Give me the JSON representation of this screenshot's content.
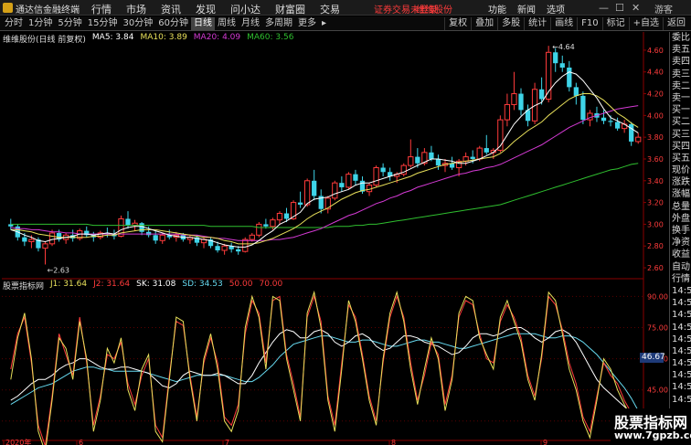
{
  "app": {
    "title": "通达信金融终端",
    "menu": [
      "行情",
      "市场",
      "资讯",
      "发现",
      "问小达",
      "财富圈",
      "交易"
    ],
    "notice": "证券交易未登录",
    "stock_link": "维维股份",
    "right_menu": [
      "功能",
      "新闻",
      "选项"
    ],
    "guest_label": "游客",
    "win_min": "—",
    "win_max": "☐",
    "win_close": "✕"
  },
  "toolbar": {
    "periods": [
      "分时",
      "1分钟",
      "5分钟",
      "15分钟",
      "30分钟",
      "60分钟",
      "日线",
      "周线",
      "月线",
      "多周期",
      "更多"
    ],
    "active_period": "日线",
    "more_arrow": "▸",
    "right_tools": [
      "复权",
      "叠加",
      "多股",
      "统计",
      "画线",
      "F10",
      "标记",
      "+自选",
      "返回"
    ]
  },
  "main_chart": {
    "stock_label": "维维股份(日线 前复权)",
    "ma_labels": [
      {
        "text": "MA5: 3.84",
        "color": "#ffffff"
      },
      {
        "text": "MA10: 3.89",
        "color": "#e8e05a"
      },
      {
        "text": "MA20: 4.09",
        "color": "#d43ad4"
      },
      {
        "text": "MA60: 3.56",
        "color": "#2fbf2f"
      }
    ],
    "y_ticks": [
      "4.60",
      "4.40",
      "4.20",
      "4.00",
      "3.80",
      "3.60",
      "3.40",
      "3.20",
      "3.00",
      "2.80",
      "2.60"
    ],
    "high_label": "4.64",
    "low_label": "2.63"
  },
  "indicator": {
    "title": "股票指标网",
    "values": [
      {
        "text": "J1: 31.64",
        "color": "#e8e05a"
      },
      {
        "text": "J2: 31.64",
        "color": "#ff3b3b"
      },
      {
        "text": "SK: 31.08",
        "color": "#ffffff"
      },
      {
        "text": "SD: 34.53",
        "color": "#66d9ef"
      },
      {
        "text": "50.00",
        "color": "#ff3b3b"
      },
      {
        "text": "70.00",
        "color": "#ff3b3b"
      }
    ],
    "y_ticks": [
      "90.00",
      "75.00",
      "60.00",
      "45.00",
      "30.00"
    ],
    "current_tag": "46.67"
  },
  "x_axis": {
    "labels": [
      "2020年",
      "6",
      "7",
      "8",
      "9"
    ]
  },
  "right_panel": {
    "items": [
      "委比",
      "卖五",
      "卖四",
      "卖三",
      "卖二",
      "卖一",
      "买一",
      "买二",
      "买三",
      "买四",
      "买五",
      "现价",
      "涨跌",
      "涨幅",
      "总量",
      "外盘",
      "换手",
      "净资",
      "收益",
      "自动",
      "行情",
      "14:56",
      "14:56",
      "14:56",
      "14:56",
      "14:56",
      "14:56",
      "14:56",
      "14:56",
      "14:56",
      "14:56"
    ]
  },
  "watermark": {
    "title": "股票指标网",
    "url": "www.7gpzb.com"
  },
  "colors": {
    "up": "#ff3b3b",
    "down": "#3ed4e8",
    "ma5": "#ffffff",
    "ma10": "#e8e05a",
    "ma20": "#d43ad4",
    "ma60": "#2fbf2f",
    "grid": "#5a0000"
  },
  "candles": [
    [
      3.0,
      3.05,
      2.95,
      2.98
    ],
    [
      2.98,
      3.0,
      2.85,
      2.88
    ],
    [
      2.88,
      2.92,
      2.8,
      2.84
    ],
    [
      2.84,
      2.9,
      2.78,
      2.86
    ],
    [
      2.86,
      2.88,
      2.75,
      2.78
    ],
    [
      2.78,
      2.84,
      2.63,
      2.82
    ],
    [
      2.82,
      2.95,
      2.8,
      2.92
    ],
    [
      2.92,
      2.95,
      2.84,
      2.86
    ],
    [
      2.86,
      2.92,
      2.82,
      2.9
    ],
    [
      2.9,
      2.95,
      2.84,
      2.87
    ],
    [
      2.87,
      2.96,
      2.85,
      2.94
    ],
    [
      2.94,
      2.98,
      2.88,
      2.9
    ],
    [
      2.9,
      2.93,
      2.84,
      2.88
    ],
    [
      2.88,
      2.94,
      2.86,
      2.92
    ],
    [
      2.92,
      2.97,
      2.88,
      2.91
    ],
    [
      2.91,
      2.95,
      2.86,
      2.89
    ],
    [
      2.89,
      3.08,
      2.88,
      3.05
    ],
    [
      3.05,
      3.12,
      2.96,
      2.99
    ],
    [
      2.99,
      3.04,
      2.94,
      3.01
    ],
    [
      3.01,
      3.02,
      2.9,
      2.93
    ],
    [
      2.93,
      2.98,
      2.88,
      2.9
    ],
    [
      2.9,
      2.94,
      2.82,
      2.85
    ],
    [
      2.85,
      2.92,
      2.82,
      2.9
    ],
    [
      2.9,
      2.95,
      2.86,
      2.88
    ],
    [
      2.88,
      2.93,
      2.84,
      2.9
    ],
    [
      2.9,
      2.92,
      2.84,
      2.86
    ],
    [
      2.86,
      2.9,
      2.82,
      2.88
    ],
    [
      2.88,
      2.9,
      2.8,
      2.83
    ],
    [
      2.83,
      2.88,
      2.78,
      2.86
    ],
    [
      2.86,
      2.88,
      2.78,
      2.8
    ],
    [
      2.8,
      2.84,
      2.74,
      2.76
    ],
    [
      2.76,
      2.82,
      2.72,
      2.8
    ],
    [
      2.8,
      2.83,
      2.74,
      2.77
    ],
    [
      2.77,
      2.8,
      2.72,
      2.75
    ],
    [
      2.75,
      2.88,
      2.74,
      2.86
    ],
    [
      2.86,
      2.92,
      2.84,
      2.9
    ],
    [
      2.9,
      3.02,
      2.88,
      3.0
    ],
    [
      3.0,
      3.05,
      2.96,
      2.98
    ],
    [
      2.98,
      3.06,
      2.95,
      3.04
    ],
    [
      3.04,
      3.12,
      3.0,
      3.1
    ],
    [
      3.1,
      3.15,
      3.02,
      3.05
    ],
    [
      3.05,
      3.22,
      3.04,
      3.2
    ],
    [
      3.2,
      3.3,
      3.15,
      3.18
    ],
    [
      3.18,
      3.42,
      3.16,
      3.4
    ],
    [
      3.4,
      3.5,
      3.22,
      3.26
    ],
    [
      3.26,
      3.32,
      3.1,
      3.14
    ],
    [
      3.14,
      3.26,
      3.1,
      3.24
    ],
    [
      3.24,
      3.4,
      3.22,
      3.38
    ],
    [
      3.38,
      3.44,
      3.3,
      3.34
    ],
    [
      3.34,
      3.48,
      3.32,
      3.46
    ],
    [
      3.46,
      3.5,
      3.36,
      3.4
    ],
    [
      3.4,
      3.44,
      3.28,
      3.3
    ],
    [
      3.3,
      3.38,
      3.26,
      3.36
    ],
    [
      3.36,
      3.54,
      3.34,
      3.52
    ],
    [
      3.52,
      3.56,
      3.44,
      3.48
    ],
    [
      3.48,
      3.52,
      3.4,
      3.44
    ],
    [
      3.44,
      3.48,
      3.38,
      3.46
    ],
    [
      3.46,
      3.56,
      3.44,
      3.54
    ],
    [
      3.54,
      3.78,
      3.52,
      3.62
    ],
    [
      3.62,
      3.7,
      3.52,
      3.56
    ],
    [
      3.56,
      3.7,
      3.54,
      3.66
    ],
    [
      3.66,
      3.72,
      3.58,
      3.6
    ],
    [
      3.6,
      3.64,
      3.5,
      3.54
    ],
    [
      3.54,
      3.6,
      3.48,
      3.56
    ],
    [
      3.56,
      3.62,
      3.5,
      3.52
    ],
    [
      3.52,
      3.6,
      3.44,
      3.58
    ],
    [
      3.58,
      3.66,
      3.54,
      3.62
    ],
    [
      3.62,
      3.68,
      3.56,
      3.6
    ],
    [
      3.6,
      3.72,
      3.58,
      3.7
    ],
    [
      3.7,
      3.82,
      3.64,
      3.66
    ],
    [
      3.66,
      3.7,
      3.6,
      3.68
    ],
    [
      3.68,
      4.0,
      3.66,
      3.96
    ],
    [
      3.96,
      4.2,
      3.9,
      4.1
    ],
    [
      4.1,
      4.4,
      4.05,
      4.2
    ],
    [
      4.2,
      4.25,
      4.0,
      4.05
    ],
    [
      4.05,
      4.1,
      3.9,
      3.95
    ],
    [
      3.95,
      4.3,
      3.92,
      4.24
    ],
    [
      4.24,
      4.35,
      4.1,
      4.15
    ],
    [
      4.15,
      4.64,
      4.12,
      4.58
    ],
    [
      4.58,
      4.62,
      4.4,
      4.48
    ],
    [
      4.48,
      4.55,
      4.4,
      4.44
    ],
    [
      4.44,
      4.5,
      4.22,
      4.26
    ],
    [
      4.26,
      4.3,
      4.1,
      4.18
    ],
    [
      4.18,
      4.22,
      3.92,
      3.96
    ],
    [
      3.96,
      4.05,
      3.9,
      4.02
    ],
    [
      4.02,
      4.08,
      3.94,
      3.98
    ],
    [
      3.98,
      4.05,
      3.92,
      3.95
    ],
    [
      3.95,
      4.0,
      3.9,
      3.94
    ],
    [
      3.94,
      3.98,
      3.86,
      3.88
    ],
    [
      3.88,
      3.96,
      3.84,
      3.92
    ],
    [
      3.92,
      3.94,
      3.72,
      3.76
    ],
    [
      3.76,
      3.84,
      3.74,
      3.8
    ]
  ],
  "ma_series": {
    "ma5": [
      2.95,
      2.93,
      2.9,
      2.88,
      2.85,
      2.84,
      2.86,
      2.87,
      2.88,
      2.89,
      2.91,
      2.91,
      2.9,
      2.91,
      2.92,
      2.91,
      2.95,
      2.97,
      2.98,
      2.98,
      2.96,
      2.94,
      2.92,
      2.9,
      2.89,
      2.88,
      2.88,
      2.87,
      2.86,
      2.85,
      2.83,
      2.81,
      2.8,
      2.79,
      2.79,
      2.81,
      2.85,
      2.9,
      2.94,
      3.0,
      3.03,
      3.07,
      3.11,
      3.19,
      3.23,
      3.24,
      3.25,
      3.28,
      3.3,
      3.32,
      3.36,
      3.38,
      3.38,
      3.4,
      3.42,
      3.44,
      3.46,
      3.48,
      3.51,
      3.54,
      3.57,
      3.6,
      3.6,
      3.59,
      3.58,
      3.56,
      3.56,
      3.58,
      3.6,
      3.63,
      3.66,
      3.72,
      3.82,
      3.92,
      3.99,
      4.05,
      4.09,
      4.12,
      4.22,
      4.3,
      4.36,
      4.4,
      4.38,
      4.32,
      4.24,
      4.16,
      4.06,
      3.98,
      3.95,
      3.92,
      3.88,
      3.84
    ],
    "ma10": [
      2.95,
      2.95,
      2.94,
      2.93,
      2.91,
      2.9,
      2.89,
      2.88,
      2.88,
      2.88,
      2.88,
      2.88,
      2.89,
      2.89,
      2.9,
      2.9,
      2.92,
      2.93,
      2.94,
      2.95,
      2.95,
      2.95,
      2.94,
      2.93,
      2.92,
      2.91,
      2.9,
      2.89,
      2.88,
      2.88,
      2.87,
      2.85,
      2.84,
      2.82,
      2.82,
      2.82,
      2.83,
      2.85,
      2.87,
      2.9,
      2.93,
      2.96,
      3.0,
      3.05,
      3.09,
      3.12,
      3.15,
      3.19,
      3.23,
      3.26,
      3.29,
      3.31,
      3.32,
      3.34,
      3.36,
      3.38,
      3.4,
      3.42,
      3.44,
      3.47,
      3.49,
      3.51,
      3.53,
      3.55,
      3.56,
      3.57,
      3.58,
      3.59,
      3.6,
      3.61,
      3.62,
      3.65,
      3.7,
      3.76,
      3.81,
      3.86,
      3.9,
      3.94,
      4.0,
      4.05,
      4.1,
      4.15,
      4.18,
      4.2,
      4.2,
      4.18,
      4.14,
      4.08,
      4.02,
      3.98,
      3.93,
      3.89
    ],
    "ma20": [
      2.97,
      2.96,
      2.96,
      2.95,
      2.95,
      2.94,
      2.93,
      2.93,
      2.92,
      2.92,
      2.91,
      2.91,
      2.91,
      2.91,
      2.91,
      2.91,
      2.91,
      2.91,
      2.91,
      2.91,
      2.91,
      2.91,
      2.91,
      2.91,
      2.91,
      2.9,
      2.9,
      2.9,
      2.89,
      2.88,
      2.87,
      2.87,
      2.86,
      2.85,
      2.85,
      2.85,
      2.85,
      2.85,
      2.86,
      2.86,
      2.87,
      2.88,
      2.9,
      2.92,
      2.94,
      2.96,
      2.99,
      3.02,
      3.05,
      3.08,
      3.1,
      3.13,
      3.16,
      3.19,
      3.21,
      3.24,
      3.26,
      3.29,
      3.31,
      3.34,
      3.36,
      3.38,
      3.4,
      3.42,
      3.44,
      3.46,
      3.47,
      3.49,
      3.5,
      3.52,
      3.53,
      3.55,
      3.58,
      3.61,
      3.64,
      3.67,
      3.7,
      3.73,
      3.77,
      3.81,
      3.85,
      3.89,
      3.92,
      3.95,
      3.98,
      4.0,
      4.02,
      4.04,
      4.06,
      4.07,
      4.08,
      4.09
    ],
    "ma60": [
      3.0,
      3.0,
      3.0,
      3.0,
      3.0,
      3.0,
      3.0,
      3.0,
      3.0,
      3.0,
      3.0,
      3.0,
      2.99,
      2.99,
      2.99,
      2.99,
      2.99,
      2.99,
      2.99,
      2.99,
      2.99,
      2.99,
      2.99,
      2.99,
      2.99,
      2.99,
      2.99,
      2.99,
      2.99,
      2.98,
      2.98,
      2.98,
      2.98,
      2.98,
      2.98,
      2.98,
      2.97,
      2.97,
      2.97,
      2.97,
      2.97,
      2.97,
      2.97,
      2.97,
      2.97,
      2.97,
      2.97,
      2.98,
      2.98,
      2.98,
      2.99,
      2.99,
      3.0,
      3.0,
      3.01,
      3.02,
      3.03,
      3.04,
      3.05,
      3.06,
      3.07,
      3.08,
      3.09,
      3.1,
      3.11,
      3.12,
      3.13,
      3.14,
      3.15,
      3.16,
      3.17,
      3.18,
      3.2,
      3.22,
      3.24,
      3.26,
      3.28,
      3.3,
      3.32,
      3.34,
      3.36,
      3.38,
      3.4,
      3.42,
      3.44,
      3.46,
      3.48,
      3.5,
      3.51,
      3.53,
      3.55,
      3.56
    ]
  },
  "kdj_series": {
    "j1": [
      50,
      70,
      82,
      60,
      25,
      15,
      40,
      70,
      65,
      50,
      78,
      60,
      25,
      40,
      65,
      58,
      70,
      45,
      35,
      55,
      62,
      25,
      20,
      50,
      80,
      78,
      50,
      30,
      60,
      72,
      55,
      30,
      25,
      35,
      75,
      90,
      80,
      55,
      90,
      88,
      60,
      45,
      30,
      82,
      92,
      75,
      40,
      25,
      55,
      88,
      78,
      60,
      40,
      28,
      60,
      82,
      92,
      78,
      55,
      38,
      55,
      70,
      60,
      35,
      50,
      82,
      90,
      88,
      70,
      62,
      55,
      80,
      88,
      78,
      68,
      50,
      40,
      62,
      92,
      88,
      72,
      55,
      45,
      30,
      22,
      40,
      60,
      55,
      45,
      38,
      32,
      32
    ],
    "j2": [
      55,
      72,
      80,
      58,
      28,
      18,
      42,
      72,
      62,
      52,
      80,
      58,
      28,
      42,
      62,
      60,
      68,
      48,
      38,
      52,
      60,
      28,
      22,
      52,
      78,
      76,
      52,
      32,
      58,
      70,
      58,
      32,
      28,
      38,
      72,
      88,
      82,
      58,
      88,
      90,
      62,
      48,
      32,
      80,
      90,
      78,
      42,
      28,
      58,
      86,
      80,
      62,
      42,
      30,
      58,
      80,
      90,
      80,
      58,
      40,
      52,
      68,
      62,
      38,
      52,
      80,
      88,
      86,
      72,
      60,
      58,
      78,
      86,
      80,
      70,
      52,
      42,
      60,
      90,
      86,
      74,
      58,
      48,
      32,
      25,
      42,
      58,
      52,
      48,
      40,
      34,
      31
    ],
    "sk": [
      40,
      42,
      45,
      48,
      50,
      50,
      52,
      55,
      57,
      58,
      60,
      60,
      58,
      56,
      55,
      55,
      56,
      56,
      55,
      54,
      53,
      50,
      47,
      46,
      48,
      52,
      54,
      53,
      52,
      52,
      53,
      52,
      50,
      48,
      48,
      52,
      58,
      63,
      68,
      72,
      74,
      73,
      70,
      70,
      73,
      74,
      72,
      68,
      66,
      68,
      71,
      72,
      70,
      66,
      64,
      65,
      68,
      71,
      71,
      70,
      68,
      67,
      66,
      64,
      62,
      63,
      66,
      70,
      72,
      72,
      71,
      72,
      74,
      75,
      75,
      73,
      70,
      68,
      70,
      73,
      74,
      72,
      68,
      62,
      56,
      50,
      46,
      43,
      40,
      37,
      34,
      31
    ],
    "sd": [
      38,
      40,
      42,
      44,
      46,
      47,
      48,
      50,
      52,
      54,
      55,
      56,
      56,
      55,
      55,
      54,
      54,
      54,
      54,
      54,
      53,
      52,
      51,
      50,
      49,
      50,
      51,
      52,
      52,
      52,
      52,
      52,
      51,
      50,
      49,
      49,
      51,
      54,
      57,
      61,
      64,
      67,
      68,
      69,
      70,
      71,
      71,
      70,
      69,
      68,
      68,
      69,
      69,
      68,
      67,
      66,
      66,
      67,
      68,
      69,
      69,
      68,
      68,
      67,
      66,
      65,
      65,
      66,
      67,
      68,
      69,
      70,
      71,
      72,
      72,
      72,
      72,
      71,
      70,
      70,
      71,
      71,
      70,
      68,
      65,
      62,
      58,
      54,
      50,
      46,
      41,
      35
    ]
  }
}
